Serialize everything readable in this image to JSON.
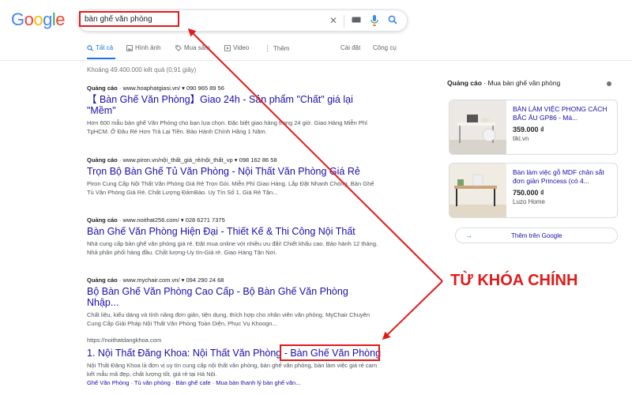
{
  "logo": {
    "text": "Google"
  },
  "search": {
    "query": "bàn ghế văn phòng"
  },
  "tabs": [
    {
      "label": "Tất cả",
      "icon": "search-icon",
      "active": true
    },
    {
      "label": "Hình ảnh",
      "icon": "image-icon"
    },
    {
      "label": "Mua sắm",
      "icon": "tag-icon"
    },
    {
      "label": "Video",
      "icon": "video-icon"
    },
    {
      "label": "Thêm",
      "icon": "more-dots-icon"
    }
  ],
  "tools": {
    "settings": "Cài đặt",
    "tools": "Công cụ"
  },
  "stats": "Khoảng 49.400.000 kết quả (0,91 giây)",
  "results": [
    {
      "ad_label": "Quảng cáo",
      "url": "www.hoaphatgiasi.vn/",
      "phone": "090 965 89 56",
      "title": "【 Bàn Ghế Văn Phòng】Giao 24h - Sản phẩm \"Chất\" giá lại \"Mềm\"",
      "desc": "Hơn 600 mẫu bàn ghế Văn Phòng cho bạn lựa chọn. Đặc biệt giao hàng trong 24 giờ. Giao Hàng Miễn Phí TpHCM. Ở Đâu Rẻ Hơn Trả Lại Tiền. Bảo Hành Chính Hãng 1 Năm."
    },
    {
      "ad_label": "Quảng cáo",
      "url": "www.piron.vn/nội_thất_giá_rẻ/nội_thất_vp",
      "phone": "098 162 86 58",
      "title": "Trọn Bộ Bàn Ghế Tủ Văn Phòng - Nội Thất Văn Phòng Giá Rẻ",
      "desc": "Piron Cung Cấp Nội Thất Văn Phòng Giá Rẻ Trọn Gói. Miễn Phí Giao Hàng. Lắp Đặt Nhanh Chóng. Bàn Ghế Tủ Văn Phòng Giá Rẻ. Chất Lượng ĐảmBảo. Uy Tín Số 1. Giá Rẻ Tận..."
    },
    {
      "ad_label": "Quảng cáo",
      "url": "www.noithat256.com/",
      "phone": "028 6271 7375",
      "title": "Bàn Ghế Văn Phòng Hiện Đại - Thiết Kế & Thi Công Nội Thất",
      "desc": "Nhà cung cấp bàn ghế văn phòng giá rẻ. Đặt mua online với nhiều ưu đãi! Chiết khấu cao. Bảo hành 12 tháng. Nhà phân phối hàng đầu. Chất lượng-Uy tín-Giá rẻ. Giao Hàng Tận Nơi."
    },
    {
      "ad_label": "Quảng cáo",
      "url": "www.mychair.com.vn/",
      "phone": "094 290 24 68",
      "title": "Bộ Bàn Ghế Văn Phòng Cao Cấp - Bộ Bàn Ghế Văn Phòng Nhập...",
      "desc": "Chất liệu, kiểu dáng và tính năng đơn giản, tiện dụng, thích hợp cho nhân viên văn phòng. MyChair Chuyên Cung Cấp Giải Pháp Nội Thất Văn Phòng Toàn Diện, Phục Vụ Khoogn..."
    },
    {
      "ad_label": "",
      "url": "https://noithatdangkhoa.com",
      "phone": "",
      "title_prefix": "1. Nội Thất Đăng Khoa: Nội Thất Văn Phòng - ",
      "title_highlight": "Bàn Ghế Văn Phòng",
      "desc": "Nội Thất Đăng Khoa là đơn vị uy tín cung cấp nội thất văn phòng, bàn ghế văn phòng, bàn làm việc giá rẻ cam kết mẫu mã đẹp, chất lượng tốt, giá rẻ tại Hà Nội.",
      "links": "Ghế Văn Phòng · Tủ văn phòng · Bàn ghế cafe · Mua bàn thanh lý bàn ghế văn..."
    }
  ],
  "side": {
    "ad_label": "Quảng cáo",
    "heading": "Mua bàn ghế văn phòng",
    "cards": [
      {
        "title": "BÀN LÀM VIỆC PHONG CÁCH BẮC ÂU GP86 - Má...",
        "price": "359.000 ₫",
        "store": "tiki.vn"
      },
      {
        "title": "Bàn làm việc gỗ MDF chân sắt đơn giản Princess (có 4...",
        "price": "750.000 ₫",
        "store": "Luzo Home"
      }
    ],
    "more": "Thêm trên Google"
  },
  "annotation": {
    "label": "TỪ KHÓA CHÍNH",
    "color": "#e01b1b"
  },
  "colors": {
    "link": "#1a0dab",
    "accent": "#1a73e8",
    "annotation": "#e01b1b"
  }
}
